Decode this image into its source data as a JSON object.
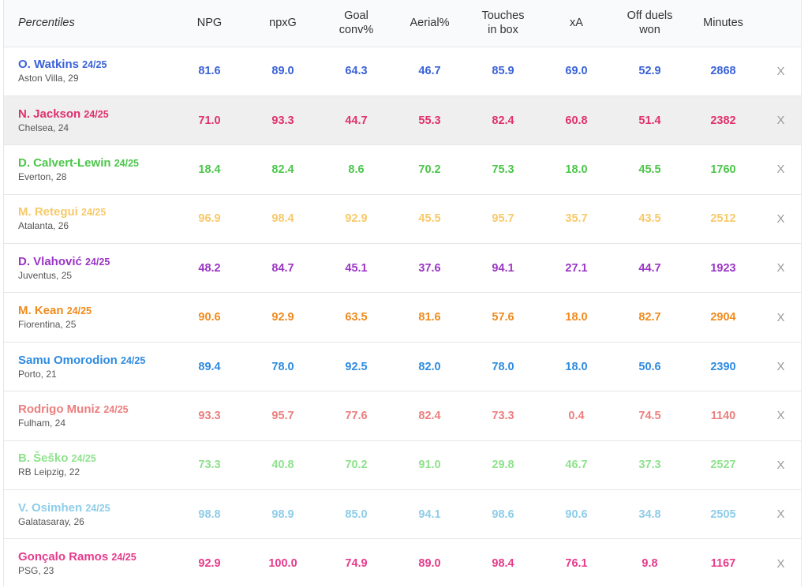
{
  "header": {
    "title": "Percentiles",
    "columns": [
      "NPG",
      "npxG",
      "Goal conv%",
      "Aerial%",
      "Touches in box",
      "xA",
      "Off duels won",
      "Minutes"
    ],
    "columns_html_breaks": [
      [
        "NPG"
      ],
      [
        "npxG"
      ],
      [
        "Goal",
        "conv%"
      ],
      [
        "Aerial%"
      ],
      [
        "Touches",
        "in box"
      ],
      [
        "xA"
      ],
      [
        "Off duels",
        "won"
      ],
      [
        "Minutes"
      ]
    ]
  },
  "remove_label": "X",
  "rows": [
    {
      "name": "O. Watkins",
      "season": "24/25",
      "club": "Aston Villa, 29",
      "color": "#3a62d8",
      "highlighted": false,
      "values": [
        "81.6",
        "89.0",
        "64.3",
        "46.7",
        "85.9",
        "69.0",
        "52.9",
        "2868"
      ]
    },
    {
      "name": "N. Jackson",
      "season": "24/25",
      "club": "Chelsea, 24",
      "color": "#e0306e",
      "highlighted": true,
      "values": [
        "71.0",
        "93.3",
        "44.7",
        "55.3",
        "82.4",
        "60.8",
        "51.4",
        "2382"
      ]
    },
    {
      "name": "D. Calvert-Lewin",
      "season": "24/25",
      "club": "Everton, 28",
      "color": "#4cc64a",
      "highlighted": false,
      "values": [
        "18.4",
        "82.4",
        "8.6",
        "70.2",
        "75.3",
        "18.0",
        "45.5",
        "1760"
      ]
    },
    {
      "name": "M. Retegui",
      "season": "24/25",
      "club": "Atalanta, 26",
      "color": "#f7c96a",
      "highlighted": false,
      "values": [
        "96.9",
        "98.4",
        "92.9",
        "45.5",
        "95.7",
        "35.7",
        "43.5",
        "2512"
      ]
    },
    {
      "name": "D. Vlahović",
      "season": "24/25",
      "club": "Juventus, 25",
      "color": "#9b35c6",
      "highlighted": false,
      "values": [
        "48.2",
        "84.7",
        "45.1",
        "37.6",
        "94.1",
        "27.1",
        "44.7",
        "1923"
      ]
    },
    {
      "name": "M. Kean",
      "season": "24/25",
      "club": "Fiorentina, 25",
      "color": "#f08a1c",
      "highlighted": false,
      "values": [
        "90.6",
        "92.9",
        "63.5",
        "81.6",
        "57.6",
        "18.0",
        "82.7",
        "2904"
      ]
    },
    {
      "name": "Samu Omorodion",
      "season": "24/25",
      "club": "Porto, 21",
      "color": "#2e8be0",
      "highlighted": false,
      "values": [
        "89.4",
        "78.0",
        "92.5",
        "82.0",
        "78.0",
        "18.0",
        "50.6",
        "2390"
      ]
    },
    {
      "name": "Rodrigo Muniz",
      "season": "24/25",
      "club": "Fulham, 24",
      "color": "#ec7e7e",
      "highlighted": false,
      "values": [
        "93.3",
        "95.7",
        "77.6",
        "82.4",
        "73.3",
        "0.4",
        "74.5",
        "1140"
      ]
    },
    {
      "name": "B. Šeško",
      "season": "24/25",
      "club": "RB Leipzig, 22",
      "color": "#8ee28c",
      "highlighted": false,
      "values": [
        "73.3",
        "40.8",
        "70.2",
        "91.0",
        "29.8",
        "46.7",
        "37.3",
        "2527"
      ]
    },
    {
      "name": "V. Osimhen",
      "season": "24/25",
      "club": "Galatasaray, 26",
      "color": "#8ecde8",
      "highlighted": false,
      "values": [
        "98.8",
        "98.9",
        "85.0",
        "94.1",
        "98.6",
        "90.6",
        "34.8",
        "2505"
      ]
    },
    {
      "name": "Gonçalo Ramos",
      "season": "24/25",
      "club": "PSG, 23",
      "color": "#e53b8c",
      "highlighted": false,
      "values": [
        "92.9",
        "100.0",
        "74.9",
        "89.0",
        "98.4",
        "76.1",
        "9.8",
        "1167"
      ]
    }
  ]
}
